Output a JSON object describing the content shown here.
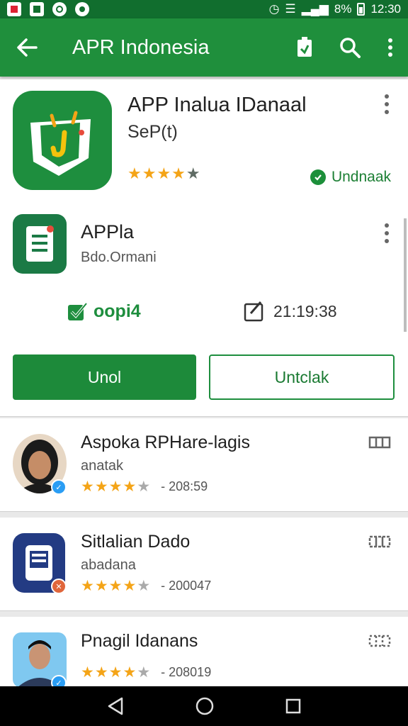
{
  "status_bar": {
    "battery": "8%",
    "time": "12:30"
  },
  "app_bar": {
    "title": "APR Indonesia"
  },
  "hero": {
    "title": "APP Inalua IDanaal",
    "subtitle": "SeP(t)",
    "rating": 4.5,
    "stars": "★★★★",
    "star_dim": "★",
    "status": "Undnaak"
  },
  "sub_app": {
    "title": "APPla",
    "developer": "Bdo.Ormani",
    "stat_left": "oopi4",
    "stat_right": "21:19:38"
  },
  "buttons": {
    "primary": "Unol",
    "secondary": "Untclak"
  },
  "list": [
    {
      "title": "Aspoka RPHare-lagis",
      "subtitle": "anatak",
      "stars": "★★★★",
      "star_dim": "★",
      "count": "- 208:59"
    },
    {
      "title": "Sitlalian Dado",
      "subtitle": "abadana",
      "stars": "★★★★",
      "star_dim": "★",
      "count": "- 200047"
    },
    {
      "title": "Pnagil Idanans",
      "subtitle": "",
      "stars": "★★★★",
      "star_dim": "★",
      "count": "- 208019"
    }
  ],
  "colors": {
    "primary": "#1f8f3c",
    "dark": "#116e2e",
    "star": "#f4a417"
  }
}
